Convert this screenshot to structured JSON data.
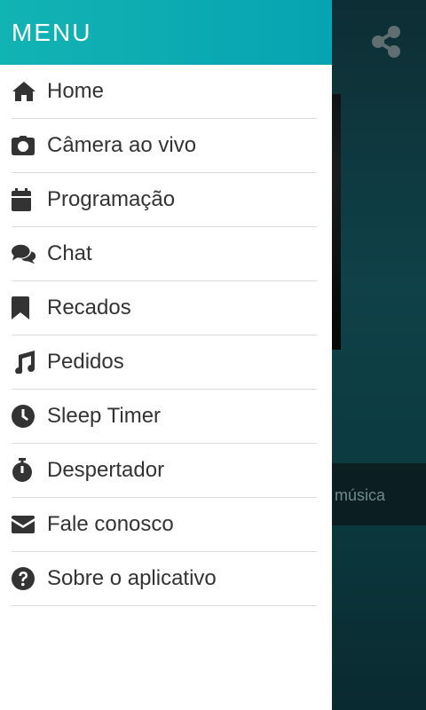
{
  "drawer": {
    "title": "MENU",
    "items": [
      {
        "label": "Home",
        "icon": "home-icon"
      },
      {
        "label": "Câmera ao vivo",
        "icon": "camera-icon"
      },
      {
        "label": "Programação",
        "icon": "calendar-icon"
      },
      {
        "label": "Chat",
        "icon": "chat-icon"
      },
      {
        "label": "Recados",
        "icon": "bookmark-icon"
      },
      {
        "label": "Pedidos",
        "icon": "music-icon"
      },
      {
        "label": "Sleep Timer",
        "icon": "clock-icon"
      },
      {
        "label": "Despertador",
        "icon": "stopwatch-icon"
      },
      {
        "label": "Fale conosco",
        "icon": "envelope-icon"
      },
      {
        "label": "Sobre o aplicativo",
        "icon": "question-icon"
      }
    ]
  },
  "background": {
    "music_text": "a música",
    "share_icon": "share-icon"
  },
  "colors": {
    "header_start": "#12b3b3",
    "header_end": "#06a4b2",
    "text": "#333333"
  }
}
